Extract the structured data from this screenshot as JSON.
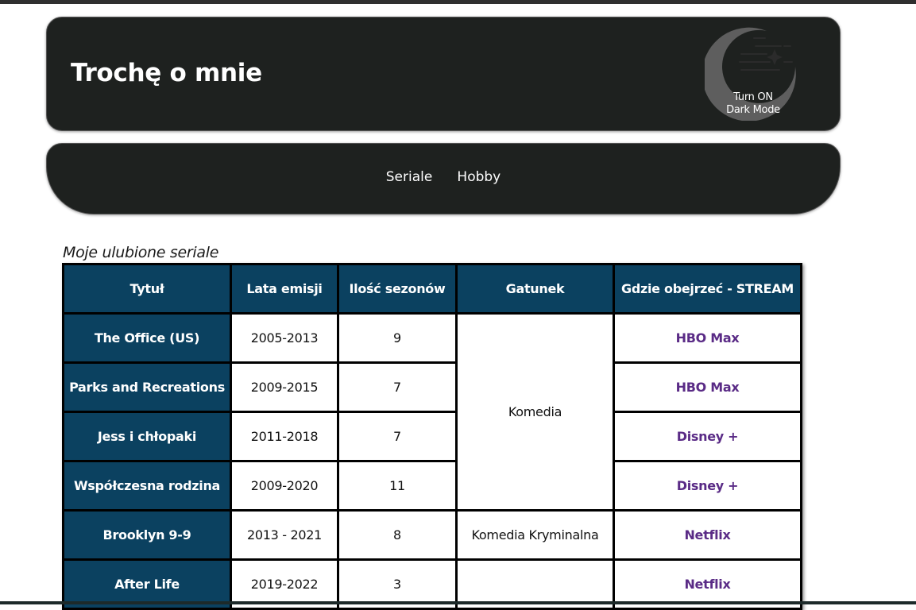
{
  "header": {
    "title": "Trochę o mnie",
    "dark_mode_line1": "Turn ON",
    "dark_mode_line2": "Dark Mode"
  },
  "nav": {
    "links": [
      {
        "label": "Seriale"
      },
      {
        "label": "Hobby"
      }
    ]
  },
  "table": {
    "caption": "Moje ulubione seriale",
    "headers": [
      "Tytuł",
      "Lata emisji",
      "Ilość sezonów",
      "Gatunek",
      "Gdzie obejrzeć - STREAM"
    ],
    "rows": [
      {
        "title": "The Office (US)",
        "years": "2005-2013",
        "seasons": "9",
        "genre": "Komedia",
        "stream": "HBO Max"
      },
      {
        "title": "Parks and Recreations",
        "years": "2009-2015",
        "seasons": "7",
        "genre": "Komedia",
        "stream": "HBO Max"
      },
      {
        "title": "Jess i chłopaki",
        "years": "2011-2018",
        "seasons": "7",
        "genre": "Komedia",
        "stream": "Disney +"
      },
      {
        "title": "Współczesna rodzina",
        "years": "2009-2020",
        "seasons": "11",
        "genre": "Komedia",
        "stream": "Disney +"
      },
      {
        "title": "Brooklyn 9-9",
        "years": "2013 - 2021",
        "seasons": "8",
        "genre": "Komedia Kryminalna",
        "stream": "Netflix"
      },
      {
        "title": "After Life",
        "years": "2019-2022",
        "seasons": "3",
        "genre": "",
        "stream": "Netflix"
      }
    ]
  },
  "colors": {
    "header_bg": "#1e211f",
    "table_header_bg": "#0b4160",
    "link_purple": "#5a2b86",
    "moon_gray": "#5e5e5e"
  },
  "icons": {
    "dark_mode": "moon-stars-icon"
  }
}
